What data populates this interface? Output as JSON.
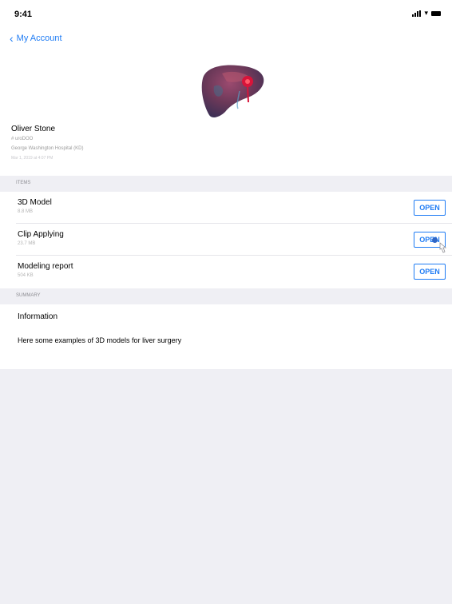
{
  "status_bar": {
    "time": "9:41",
    "icons": [
      "signal-icon",
      "wifi-icon",
      "battery-icon"
    ]
  },
  "nav": {
    "back_label": "My Account"
  },
  "profile": {
    "name": "Oliver Stone",
    "line1": "# uroDOO",
    "line2": "George Washington Hospital (KD)",
    "line3": "Mar 1, 2019 at 4:07 PM"
  },
  "sections": {
    "items_header": "ITEMS",
    "summary_header": "SUMMARY"
  },
  "items": [
    {
      "title": "3D Model",
      "size": "8.8 MB",
      "button": "OPEN"
    },
    {
      "title": "Clip Applying",
      "size": "23.7 MB",
      "button": "OPEN"
    },
    {
      "title": "Modeling report",
      "size": "504 KB",
      "button": "OPEN"
    }
  ],
  "summary": {
    "title": "Information",
    "text": "Here some examples of 3D models for liver surgery"
  },
  "colors": {
    "accent": "#1f7cf4",
    "background": "#efeff4",
    "card": "#ffffff"
  }
}
